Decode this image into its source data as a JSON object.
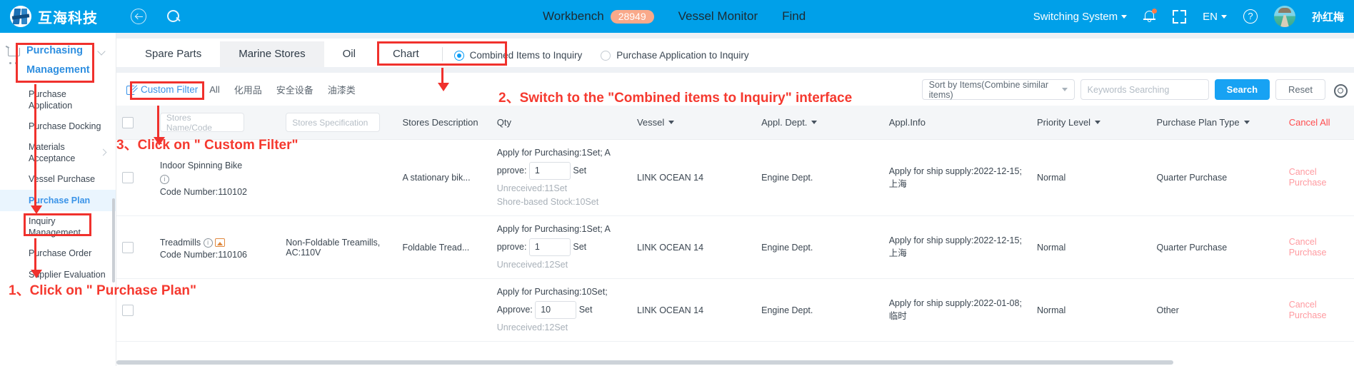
{
  "topbar": {
    "brand": "互海科技",
    "back_icon": "back-arrow-icon",
    "search_icon": "search-icon",
    "nav": [
      {
        "label": "Workbench",
        "badge": "28949"
      },
      {
        "label": "Vessel Monitor"
      },
      {
        "label": "Find"
      }
    ],
    "switching_system": "Switching System",
    "language": "EN",
    "username": "孙红梅"
  },
  "sidebar": {
    "title_line1": "Purchasing",
    "title_line2": "Management",
    "items": [
      {
        "label": "Purchase Application",
        "active": false,
        "has_chevron": false
      },
      {
        "label": "Purchase Docking",
        "active": false,
        "has_chevron": false
      },
      {
        "label": "Materials Acceptance",
        "active": false,
        "has_chevron": true
      },
      {
        "label": "Vessel Purchase",
        "active": false,
        "has_chevron": false
      },
      {
        "label": "Purchase Plan",
        "active": true,
        "has_chevron": false
      },
      {
        "label": "Inquiry Management",
        "active": false,
        "has_chevron": false
      },
      {
        "label": "Purchase Order",
        "active": false,
        "has_chevron": false
      },
      {
        "label": "Supplier Evaluation",
        "active": false,
        "has_chevron": false
      }
    ]
  },
  "tabs": [
    {
      "label": "Spare Parts",
      "active": false
    },
    {
      "label": "Marine Stores",
      "active": true
    },
    {
      "label": "Oil",
      "active": false
    },
    {
      "label": "Chart",
      "active": false
    }
  ],
  "radios": [
    {
      "label": "Combined Items to Inquiry",
      "selected": true
    },
    {
      "label": "Purchase Application to Inquiry",
      "selected": false
    }
  ],
  "filterbar": {
    "custom_filter": "Custom Filter",
    "chips": [
      "All",
      "化用品",
      "安全设备",
      "油漆类"
    ],
    "sort_select": "Sort by Items(Combine similar items)",
    "keywords_placeholder": "Keywords Searching",
    "search_button": "Search",
    "reset_button": "Reset",
    "settings_icon": "gear-icon"
  },
  "table": {
    "headers": {
      "stores_name_code": "Stores Name/Code",
      "stores_specification": "Stores Specification",
      "stores_description": "Stores Description",
      "qty": "Qty",
      "vessel": "Vessel",
      "appl_dept": "Appl. Dept.",
      "appl_info": "Appl.Info",
      "priority_level": "Priority Level",
      "purchase_plan_type": "Purchase Plan Type",
      "cancel_all": "Cancel All"
    },
    "rows": [
      {
        "name": "Indoor Spinning Bike",
        "code": "Code Number:110102",
        "specification": "",
        "description": "A stationary bik...",
        "qty_apply": "Apply for Purchasing:1Set; A",
        "qty_approve_label": "pprove:",
        "qty_approve_value": "1",
        "qty_unit": "Set",
        "qty_unreceived": "Unreceived:11Set",
        "qty_shore": "Shore-based Stock:10Set",
        "vessel": "LINK OCEAN 14",
        "dept": "Engine Dept.",
        "appl_info": "Apply for ship supply:2022-12-15;上海",
        "priority": "Normal",
        "plan_type": "Quarter Purchase",
        "cancel": "Cancel Purchase",
        "has_info_icon": true,
        "has_img_icon": false
      },
      {
        "name": "Treadmills",
        "code": "Code Number:110106",
        "specification": "Non-Foldable Treamills, AC:110V",
        "description": "Foldable Tread...",
        "qty_apply": "Apply for Purchasing:1Set; A",
        "qty_approve_label": "pprove:",
        "qty_approve_value": "1",
        "qty_unit": "Set",
        "qty_unreceived": "Unreceived:12Set",
        "qty_shore": "",
        "vessel": "LINK OCEAN 14",
        "dept": "Engine Dept.",
        "appl_info": "Apply for ship supply:2022-12-15;上海",
        "priority": "Normal",
        "plan_type": "Quarter Purchase",
        "cancel": "Cancel Purchase",
        "has_info_icon": true,
        "has_img_icon": true
      },
      {
        "name": "",
        "code": "",
        "specification": "",
        "description": "",
        "qty_apply": "Apply for Purchasing:10Set;",
        "qty_approve_label": "Approve:",
        "qty_approve_value": "10",
        "qty_unit": "Set",
        "qty_unreceived": "Unreceived:12Set",
        "qty_shore": "",
        "vessel": "LINK OCEAN 14",
        "dept": "Engine Dept.",
        "appl_info": "Apply for ship supply:2022-01-08;临时",
        "priority": "Normal",
        "plan_type": "Other",
        "cancel": "Cancel Purchase",
        "has_info_icon": false,
        "has_img_icon": false
      }
    ]
  },
  "annotations": {
    "step1": "1、Click on \" Purchase Plan\"",
    "step2": "2、Switch to the \"Combined items to Inquiry\" interface",
    "step3": "3、Click  on \" Custom Filter\""
  }
}
